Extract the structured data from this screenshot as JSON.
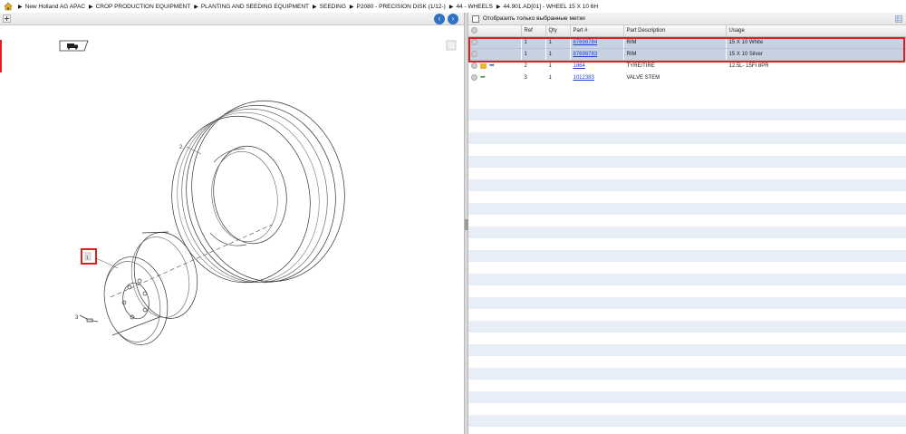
{
  "breadcrumb": {
    "items": [
      "New Holland AG APAC",
      "CROP PRODUCTION EQUIPMENT",
      "PLANTING AND SEEDING EQUIPMENT",
      "SEEDING",
      "P2080 - PRECISION DISK (1/12-)",
      "44 - WHEELS",
      "44.901.AD[01] - WHEEL 15 X 10 6H"
    ]
  },
  "icons": {
    "home": "home-icon",
    "back": "back-arrow-icon",
    "forward": "forward-arrow-icon"
  },
  "right": {
    "filter_label": "Отобразить только выбранные метки",
    "columns": [
      "",
      "Ref",
      "Qty",
      "Part #",
      "Part Description",
      "Usage"
    ],
    "rows": [
      {
        "ref": "1",
        "qty": "1",
        "part": "87698784",
        "desc": "RIM",
        "usage": "15 X 10 White",
        "selected": true
      },
      {
        "ref": "1",
        "qty": "1",
        "part": "87698783",
        "desc": "RIM",
        "usage": "15 X 10 Silver",
        "selected": true
      },
      {
        "ref": "2",
        "qty": "1",
        "part": "1864",
        "desc": "TYRE/TIRE",
        "usage": "12.5L- 15FI 8PR",
        "selected": false
      },
      {
        "ref": "3",
        "qty": "1",
        "part": "1012383",
        "desc": "VALVE STEM",
        "usage": "",
        "selected": false
      }
    ]
  },
  "diagram": {
    "callouts": [
      "2",
      "1",
      "3"
    ]
  },
  "colors": {
    "selected_row": "#c6d2e2",
    "alt_row": "#e8eef7",
    "link": "#1a3fd8",
    "highlight": "#e02020",
    "nav_button": "#2f72c4"
  }
}
